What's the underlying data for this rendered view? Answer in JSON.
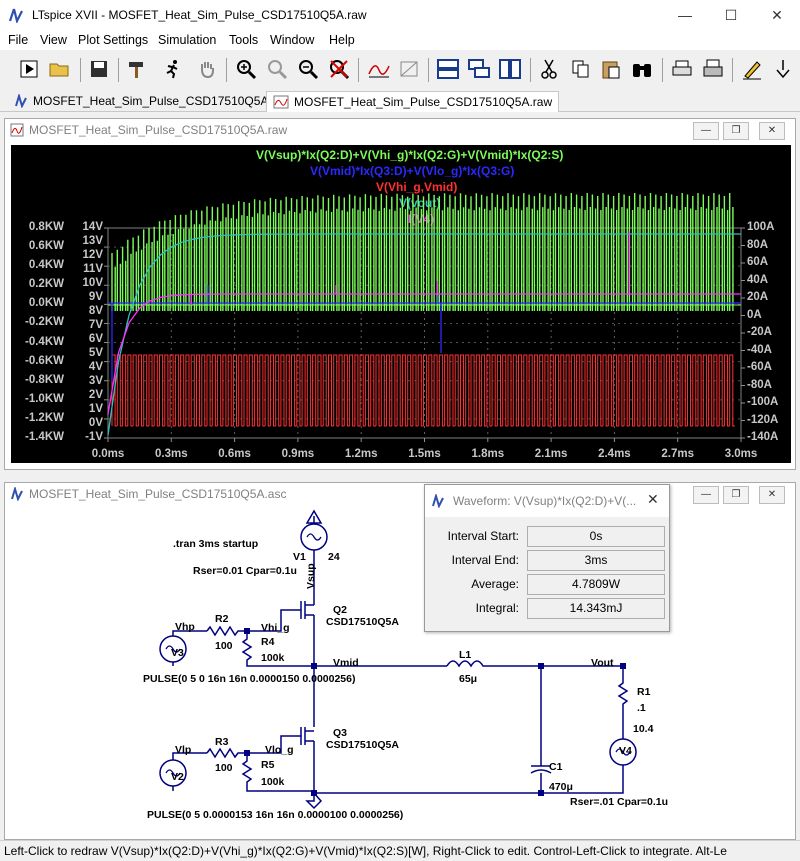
{
  "window": {
    "title": "LTspice XVII - MOSFET_Heat_Sim_Pulse_CSD17510Q5A.raw"
  },
  "menu": [
    "File",
    "View",
    "Plot Settings",
    "Simulation",
    "Tools",
    "Window",
    "Help"
  ],
  "tabs": [
    {
      "label": "MOSFET_Heat_Sim_Pulse_CSD17510Q5A.asc",
      "active": false
    },
    {
      "label": "MOSFET_Heat_Sim_Pulse_CSD17510Q5A.raw",
      "active": true
    }
  ],
  "plot_window": {
    "title": "MOSFET_Heat_Sim_Pulse_CSD17510Q5A.raw"
  },
  "schematic_window": {
    "title": "MOSFET_Heat_Sim_Pulse_CSD17510Q5A.asc"
  },
  "chart_data": {
    "type": "line",
    "series": [
      {
        "name": "V(Vsup)*Ix(Q2:D)+V(Vhi_g)*Ix(Q2:G)+V(Vmid)*Ix(Q2:S)",
        "color": "#7cfc5a"
      },
      {
        "name": "V(Vmid)*Ix(Q3:D)+V(Vlo_g)*Ix(Q3:G)",
        "color": "#2a2aff"
      },
      {
        "name": "V(Vhi_g,Vmid)",
        "color": "#ff3030"
      },
      {
        "name": "V(vout)",
        "color": "#30c0c0"
      },
      {
        "name": "I(V4)",
        "color": "#ff30ff"
      }
    ],
    "left_axis_kw": [
      "0.8KW",
      "0.6KW",
      "0.4KW",
      "0.2KW",
      "0.0KW",
      "-0.2KW",
      "-0.4KW",
      "-0.6KW",
      "-0.8KW",
      "-1.0KW",
      "-1.2KW",
      "-1.4KW"
    ],
    "left_axis_v": [
      "14V",
      "13V",
      "12V",
      "11V",
      "10V",
      "9V",
      "8V",
      "7V",
      "6V",
      "5V",
      "4V",
      "3V",
      "2V",
      "1V",
      "0V",
      "-1V"
    ],
    "right_axis": [
      "100A",
      "80A",
      "60A",
      "40A",
      "20A",
      "0A",
      "-20A",
      "-40A",
      "-60A",
      "-80A",
      "-100A",
      "-120A",
      "-140A"
    ],
    "x_ticks": [
      "0.0ms",
      "0.3ms",
      "0.6ms",
      "0.9ms",
      "1.2ms",
      "1.5ms",
      "1.8ms",
      "2.1ms",
      "2.4ms",
      "2.7ms",
      "3.0ms"
    ],
    "xlim": [
      0,
      3.0
    ],
    "pulse_count": 118
  },
  "dialog": {
    "title": "Waveform: V(Vsup)*Ix(Q2:D)+V(...",
    "interval_start_label": "Interval Start:",
    "interval_start": "0s",
    "interval_end_label": "Interval End:",
    "interval_end": "3ms",
    "average_label": "Average:",
    "average": "4.7809W",
    "integral_label": "Integral:",
    "integral": "14.343mJ"
  },
  "schematic": {
    "tran": ".tran 3ms startup",
    "v1": "V1",
    "v1_val": "24",
    "v1_par": "Rser=0.01 Cpar=0.1u",
    "vsup": "Vsup",
    "vhp": "Vhp",
    "v3": "V3",
    "r2": "R2",
    "r2_val": "100",
    "vhi_g": "Vhi_g",
    "r4": "R4",
    "r4_val": "100k",
    "q2": "Q2",
    "q2_part": "CSD17510Q5A",
    "vmid": "Vmid",
    "pulse_hi": "PULSE(0 5 0 16n 16n 0.0000150 0.0000256)",
    "l1": "L1",
    "l1_val": "65μ",
    "vout": "Vout",
    "r1": "R1",
    "r1_val": ".1",
    "v4_val": "10.4",
    "v4": "V4",
    "vlp": "Vlp",
    "v2": "V2",
    "r3": "R3",
    "r3_val": "100",
    "vlo_g": "Vlo_g",
    "r5": "R5",
    "r5_val": "100k",
    "q3": "Q3",
    "q3_part": "CSD17510Q5A",
    "c1": "C1",
    "c1_val": "470μ",
    "c1_par": "Rser=.01 Cpar=0.1u",
    "pulse_lo": "PULSE(0 5 0.0000153 16n 16n 0.0000100 0.0000256)"
  },
  "status": "Left-Click to redraw V(Vsup)*Ix(Q2:D)+V(Vhi_g)*Ix(Q2:G)+V(Vmid)*Ix(Q2:S)[W],  Right-Click to edit. Control-Left-Click to integrate. Alt-Le"
}
